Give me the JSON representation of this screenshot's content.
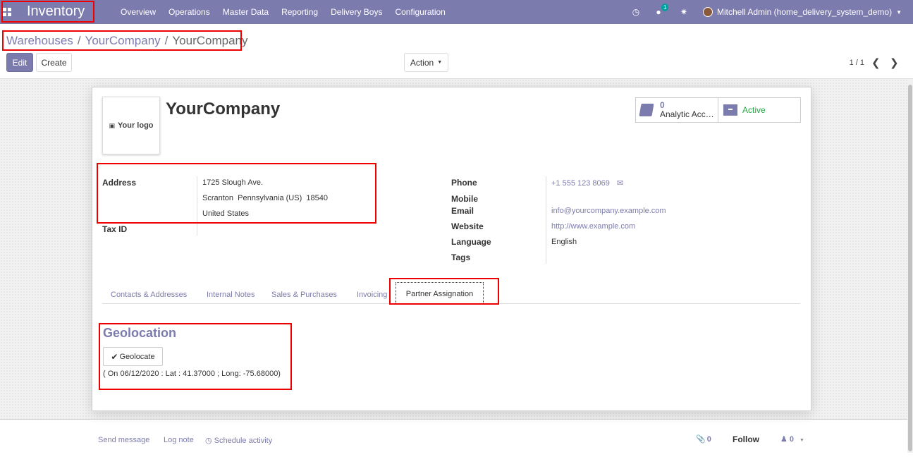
{
  "navbar": {
    "brand": "Inventory",
    "menu": [
      "Overview",
      "Operations",
      "Master Data",
      "Reporting",
      "Delivery Boys",
      "Configuration"
    ],
    "chat_badge": "1",
    "user": "Mitchell Admin (home_delivery_system_demo)"
  },
  "breadcrumb": {
    "items": [
      "Warehouses",
      "YourCompany"
    ],
    "active": "YourCompany"
  },
  "toolbar": {
    "edit_label": "Edit",
    "create_label": "Create",
    "action_label": "Action",
    "pager": "1 / 1"
  },
  "record": {
    "logo_text": "Your logo",
    "name": "YourCompany",
    "stat_analytic_count": "0",
    "stat_analytic_label": "Analytic Acc…",
    "stat_active_label": "Active"
  },
  "fields": {
    "address_label": "Address",
    "address_line1": "1725 Slough Ave.",
    "address_line2": "Scranton  Pennsylvania (US)  18540",
    "address_line3": "United States",
    "taxid_label": "Tax ID",
    "phone_label": "Phone",
    "phone_value": "+1 555 123 8069",
    "mobile_label": "Mobile",
    "email_label": "Email",
    "email_value": "info@yourcompany.example.com",
    "website_label": "Website",
    "website_value": "http://www.example.com",
    "language_label": "Language",
    "language_value": "English",
    "tags_label": "Tags"
  },
  "tabs": {
    "contacts": "Contacts & Addresses",
    "notes": "Internal Notes",
    "sales": "Sales & Purchases",
    "invoicing": "Invoicing",
    "partner": "Partner Assignation"
  },
  "geolocation": {
    "title": "Geolocation",
    "button_label": "Geolocate",
    "info": "( On 06/12/2020 : Lat : 41.37000 ;  Long: -75.68000)"
  },
  "chatter": {
    "send_message": "Send message",
    "log_note": "Log note",
    "schedule_activity": "Schedule activity",
    "attachments_count": "0",
    "follow_label": "Follow",
    "followers_count": "0"
  },
  "colors": {
    "accent": "#7c7bad",
    "annotation": "#ee0000",
    "active_green": "#28a745"
  }
}
